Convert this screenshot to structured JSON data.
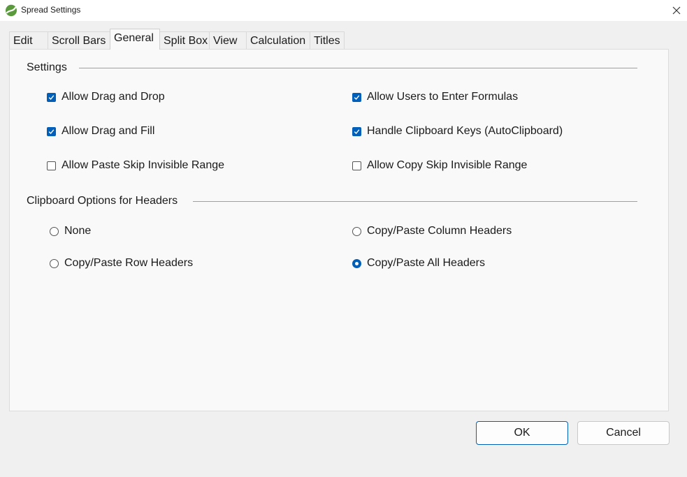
{
  "window": {
    "title": "Spread Settings",
    "app_icon": "spread-logo-icon",
    "close_icon": "close-icon"
  },
  "tabs": [
    {
      "label": "Edit",
      "active": false
    },
    {
      "label": "Scroll Bars",
      "active": false
    },
    {
      "label": "General",
      "active": true
    },
    {
      "label": "Split Box",
      "active": false
    },
    {
      "label": "View",
      "active": false
    },
    {
      "label": "Calculation",
      "active": false
    },
    {
      "label": "Titles",
      "active": false
    }
  ],
  "settings": {
    "header": "Settings",
    "options": [
      {
        "label": "Allow Drag and Drop",
        "checked": true
      },
      {
        "label": "Allow Users to Enter Formulas",
        "checked": true
      },
      {
        "label": "Allow Drag and Fill",
        "checked": true
      },
      {
        "label": "Handle Clipboard Keys (AutoClipboard)",
        "checked": true
      },
      {
        "label": "Allow Paste Skip Invisible Range",
        "checked": false
      },
      {
        "label": "Allow Copy Skip Invisible Range",
        "checked": false
      }
    ]
  },
  "clipboard": {
    "header": "Clipboard Options for Headers",
    "options": [
      {
        "label": "None",
        "selected": false
      },
      {
        "label": "Copy/Paste Column Headers",
        "selected": false
      },
      {
        "label": "Copy/Paste Row Headers",
        "selected": false
      },
      {
        "label": "Copy/Paste All Headers",
        "selected": true
      }
    ]
  },
  "buttons": {
    "ok_label": "OK",
    "cancel_label": "Cancel"
  },
  "colors": {
    "accent": "#005fb8",
    "logo_green": "#5a9a3c"
  }
}
